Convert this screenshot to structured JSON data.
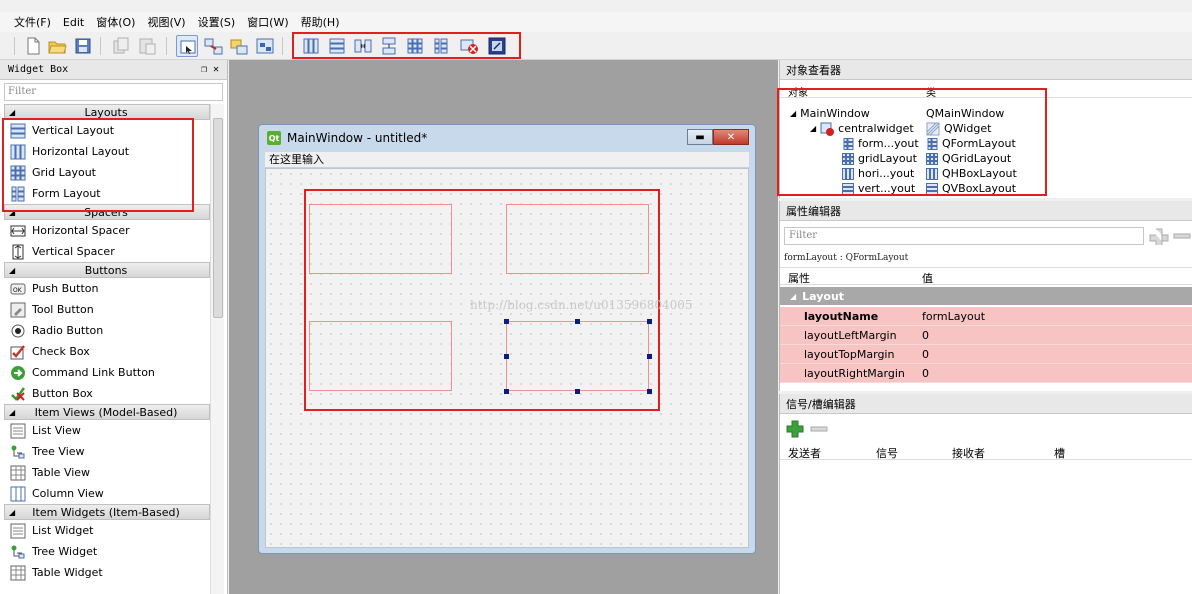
{
  "menu": [
    "文件(F)",
    "Edit",
    "窗体(O)",
    "视图(V)",
    "设置(S)",
    "窗口(W)",
    "帮助(H)"
  ],
  "widget_box": {
    "title": "Widget Box",
    "dock_buttons": "❐ ✕",
    "filter_placeholder": "Filter",
    "layouts_category": "Layouts",
    "layouts": [
      "Vertical Layout",
      "Horizontal Layout",
      "Grid Layout",
      "Form Layout"
    ],
    "spacers_category": "Spacers",
    "spacers": [
      "Horizontal Spacer",
      "Vertical Spacer"
    ],
    "buttons_category": "Buttons",
    "buttons": [
      "Push Button",
      "Tool Button",
      "Radio Button",
      "Check Box",
      "Command Link Button",
      "Button Box"
    ],
    "item_views_category": "Item Views (Model-Based)",
    "item_views": [
      "List View",
      "Tree View",
      "Table View",
      "Column View"
    ],
    "item_widgets_category": "Item Widgets (Item-Based)",
    "item_widgets": [
      "List Widget",
      "Tree Widget",
      "Table Widget"
    ]
  },
  "designer": {
    "title": "MainWindow - untitled*",
    "menu_placeholder": "在这里输入",
    "watermark": "http://blog.csdn.net/u013596804005"
  },
  "object_inspector": {
    "title": "对象查看器",
    "col_object": "对象",
    "col_class": "类",
    "rows": [
      {
        "object": "MainWindow",
        "class": "QMainWindow"
      },
      {
        "object": "centralwidget",
        "class": "QWidget"
      },
      {
        "object": "form...yout",
        "class": "QFormLayout"
      },
      {
        "object": "gridLayout",
        "class": "QGridLayout"
      },
      {
        "object": "hori...yout",
        "class": "QHBoxLayout"
      },
      {
        "object": "vert...yout",
        "class": "QVBoxLayout"
      }
    ]
  },
  "property_editor": {
    "title": "属性编辑器",
    "filter_placeholder": "Filter",
    "class_line": "formLayout : QFormLayout",
    "col_property": "属性",
    "col_value": "值",
    "group": "Layout",
    "rows": [
      {
        "name": "layoutName",
        "value": "formLayout"
      },
      {
        "name": "layoutLeftMargin",
        "value": "0"
      },
      {
        "name": "layoutTopMargin",
        "value": "0"
      },
      {
        "name": "layoutRightMargin",
        "value": "0"
      }
    ]
  },
  "signal_slot_editor": {
    "title": "信号/槽编辑器",
    "col_sender": "发送者",
    "col_signal": "信号",
    "col_receiver": "接收者",
    "col_slot": "槽"
  },
  "colors": {
    "highlight_red": "#e02020",
    "property_row_bg": "#f7c3c3",
    "selection_handle": "#0b1e80"
  }
}
